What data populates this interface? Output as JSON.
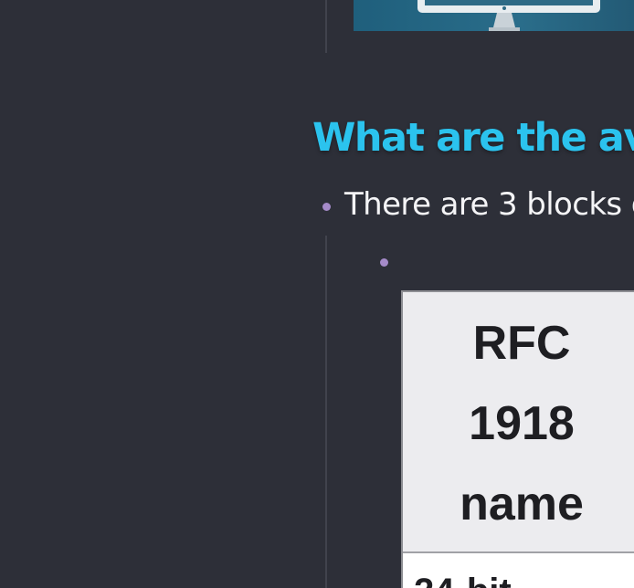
{
  "heading": "What are the av",
  "bullet_text": "There are 3 blocks o",
  "table": {
    "header_lines": [
      "RFC",
      "1918",
      "name"
    ],
    "first_cell_partial": "24-bit"
  },
  "colors": {
    "background": "#2d2f38",
    "heading": "#2bc3ee",
    "bullet": "#a58bc9",
    "text": "#f4f4f6",
    "table_header": "#ececef"
  },
  "icons": {
    "thumbnail": "desktop-monitor-icon"
  }
}
